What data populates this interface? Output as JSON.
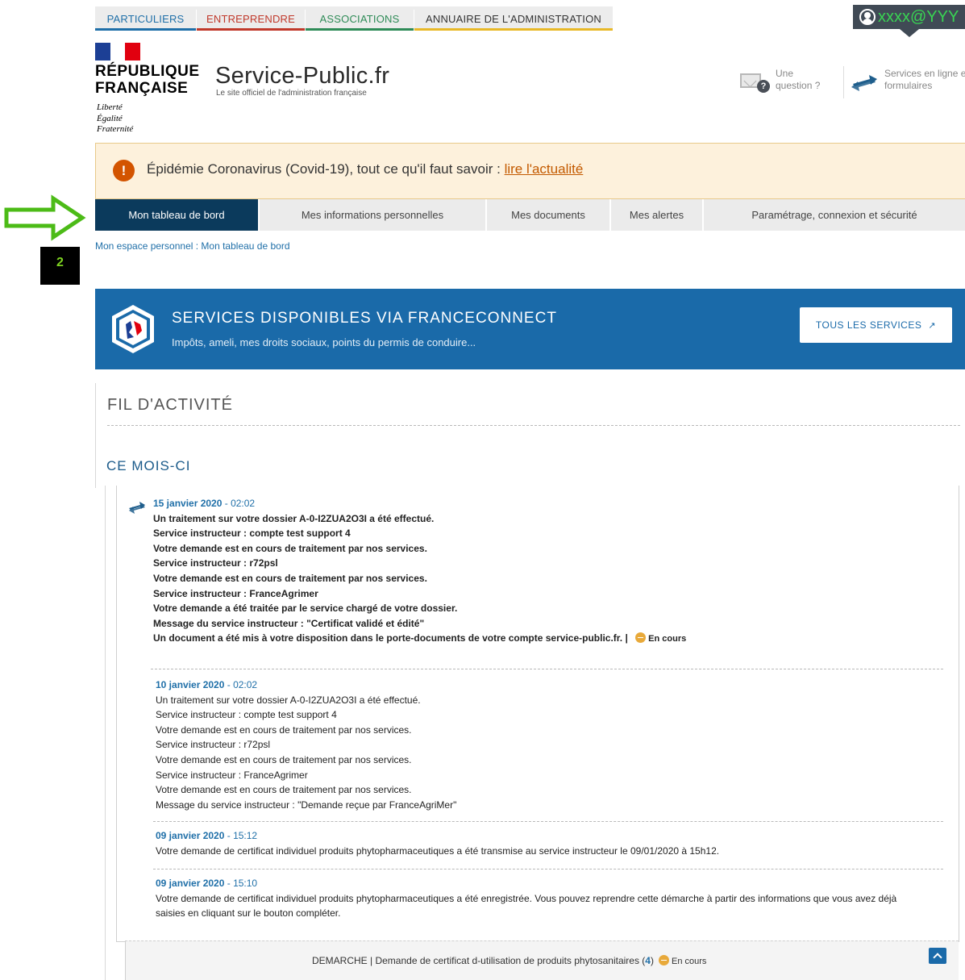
{
  "top_nav": {
    "tabs": [
      {
        "label": "PARTICULIERS",
        "color": "#1f6fa8"
      },
      {
        "label": "ENTREPRENDRE",
        "color": "#c0392b"
      },
      {
        "label": "ASSOCIATIONS",
        "color": "#2e8b57"
      },
      {
        "label": "ANNUAIRE DE L'ADMINISTRATION",
        "color": "#e8b827"
      }
    ],
    "user_email": "xxxx@YYY"
  },
  "header": {
    "republic_name": "RÉPUBLIQUE FRANÇAISE",
    "motto": [
      "Liberté",
      "Égalité",
      "Fraternité"
    ],
    "site_name": "Service-Public.fr",
    "site_tagline": "Le site officiel de l'administration française",
    "question_link": "Une question ?",
    "question_badge": "?",
    "services_link": "Services en ligne et formulaires"
  },
  "alert": {
    "icon": "!",
    "text": "Épidémie Coronavirus (Covid-19), tout ce qu'il faut savoir : ",
    "link": "lire l'actualité"
  },
  "annotation": {
    "badge": "2",
    "arrow_color": "#4cbb17"
  },
  "sub_nav": {
    "tabs": [
      {
        "label": "Mon tableau de bord",
        "active": true
      },
      {
        "label": "Mes informations personnelles",
        "active": false
      },
      {
        "label": "Mes documents",
        "active": false
      },
      {
        "label": "Mes alertes",
        "active": false
      },
      {
        "label": "Paramétrage, connexion et sécurité",
        "active": false
      }
    ]
  },
  "breadcrumb": "Mon espace personnel : Mon tableau de bord",
  "franceconnect": {
    "title": "SERVICES DISPONIBLES VIA FRANCECONNECT",
    "subtitle": "Impôts, ameli, mes droits sociaux, points du permis de conduire...",
    "button": "TOUS LES SERVICES",
    "button_icon": "external-link-icon"
  },
  "activity": {
    "title": "FIL D'ACTIVITÉ",
    "month_title": "CE MOIS-CI",
    "entries": [
      {
        "date": "15 janvier 2020",
        "time": " - 02:02",
        "lines": [
          "Un traitement sur votre dossier A-0-I2ZUA2O3I a été effectué.",
          "Service instructeur : compte test support 4",
          "Votre demande est en cours de traitement par nos services.",
          "Service instructeur : r72psl",
          "Votre demande est en cours de traitement par nos services.",
          "Service instructeur : FranceAgrimer",
          "Votre demande a été traitée par le service chargé de votre dossier.",
          "Message du service instructeur : \"Certificat validé et édité\"",
          "Un document a été mis à votre disposition dans le porte-documents de votre compte service-public.fr. | "
        ],
        "status": "En cours"
      },
      {
        "date": "10 janvier 2020",
        "time": " - 02:02",
        "lines": [
          "Un traitement sur votre dossier A-0-I2ZUA2O3I a été effectué.",
          "Service instructeur : compte test support 4",
          "Votre demande est en cours de traitement par nos services.",
          "Service instructeur : r72psl",
          "Votre demande est en cours de traitement par nos services.",
          "Service instructeur : FranceAgrimer",
          "Votre demande est en cours de traitement par nos services.",
          "Message du service instructeur : \"Demande reçue par FranceAgriMer\""
        ]
      },
      {
        "date": "09 janvier 2020",
        "time": " - 15:12",
        "lines": [
          "Votre demande de certificat individuel produits phytopharmaceutiques a été transmise au service instructeur le 09/01/2020 à 15h12."
        ]
      },
      {
        "date": "09 janvier 2020",
        "time": " - 15:10",
        "lines": [
          "Votre demande de certificat individuel produits phytopharmaceutiques a été enregistrée. Vous pouvez reprendre cette démarche à partir des informations que vous avez déjà",
          "saisies en cliquant sur le bouton compléter."
        ]
      }
    ],
    "demarche": {
      "text": "DEMARCHE | Demande de certificat d-utilisation de produits phytosanitaires (",
      "count": "4",
      "close": ")",
      "status": "En cours"
    }
  }
}
